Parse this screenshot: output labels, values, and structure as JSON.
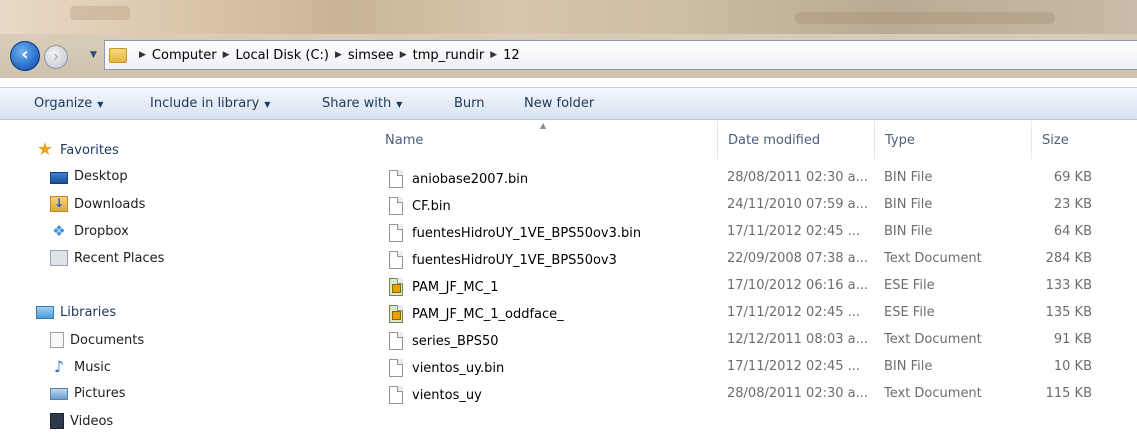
{
  "address": {
    "breadcrumbs": [
      "Computer",
      "Local Disk (C:)",
      "simsee",
      "tmp_rundir",
      "12"
    ]
  },
  "toolbar": {
    "organize": "Organize",
    "include_in_library": "Include in library",
    "share_with": "Share with",
    "burn": "Burn",
    "new_folder": "New folder"
  },
  "nav": {
    "favorites": "Favorites",
    "desktop": "Desktop",
    "downloads": "Downloads",
    "dropbox": "Dropbox",
    "recent_places": "Recent Places",
    "libraries": "Libraries",
    "documents": "Documents",
    "music": "Music",
    "pictures": "Pictures",
    "videos": "Videos"
  },
  "columns": {
    "name": "Name",
    "date_modified": "Date modified",
    "type": "Type",
    "size": "Size"
  },
  "files": [
    {
      "name": "aniobase2007.bin",
      "date": "28/08/2011 02:30 a...",
      "type": "BIN File",
      "size": "69 KB",
      "icon": "generic-file-icon"
    },
    {
      "name": "CF.bin",
      "date": "24/11/2010 07:59 a...",
      "type": "BIN File",
      "size": "23 KB",
      "icon": "generic-file-icon"
    },
    {
      "name": "fuentesHidroUY_1VE_BPS50ov3.bin",
      "date": "17/11/2012 02:45 ...",
      "type": "BIN File",
      "size": "64 KB",
      "icon": "generic-file-icon"
    },
    {
      "name": "fuentesHidroUY_1VE_BPS50ov3",
      "date": "22/09/2008 07:38 a...",
      "type": "Text Document",
      "size": "284 KB",
      "icon": "generic-file-icon"
    },
    {
      "name": "PAM_JF_MC_1",
      "date": "17/10/2012 06:16 a...",
      "type": "ESE File",
      "size": "133 KB",
      "icon": "ese-file-icon"
    },
    {
      "name": "PAM_JF_MC_1_oddface_",
      "date": "17/11/2012 02:45 ...",
      "type": "ESE File",
      "size": "135 KB",
      "icon": "ese-file-icon"
    },
    {
      "name": "series_BPS50",
      "date": "12/12/2011 08:03 a...",
      "type": "Text Document",
      "size": "91 KB",
      "icon": "generic-file-icon"
    },
    {
      "name": "vientos_uy.bin",
      "date": "17/11/2012 02:45 ...",
      "type": "BIN File",
      "size": "10 KB",
      "icon": "generic-file-icon"
    },
    {
      "name": "vientos_uy",
      "date": "28/08/2011 02:30 a...",
      "type": "Text Document",
      "size": "115 KB",
      "icon": "generic-file-icon"
    }
  ]
}
